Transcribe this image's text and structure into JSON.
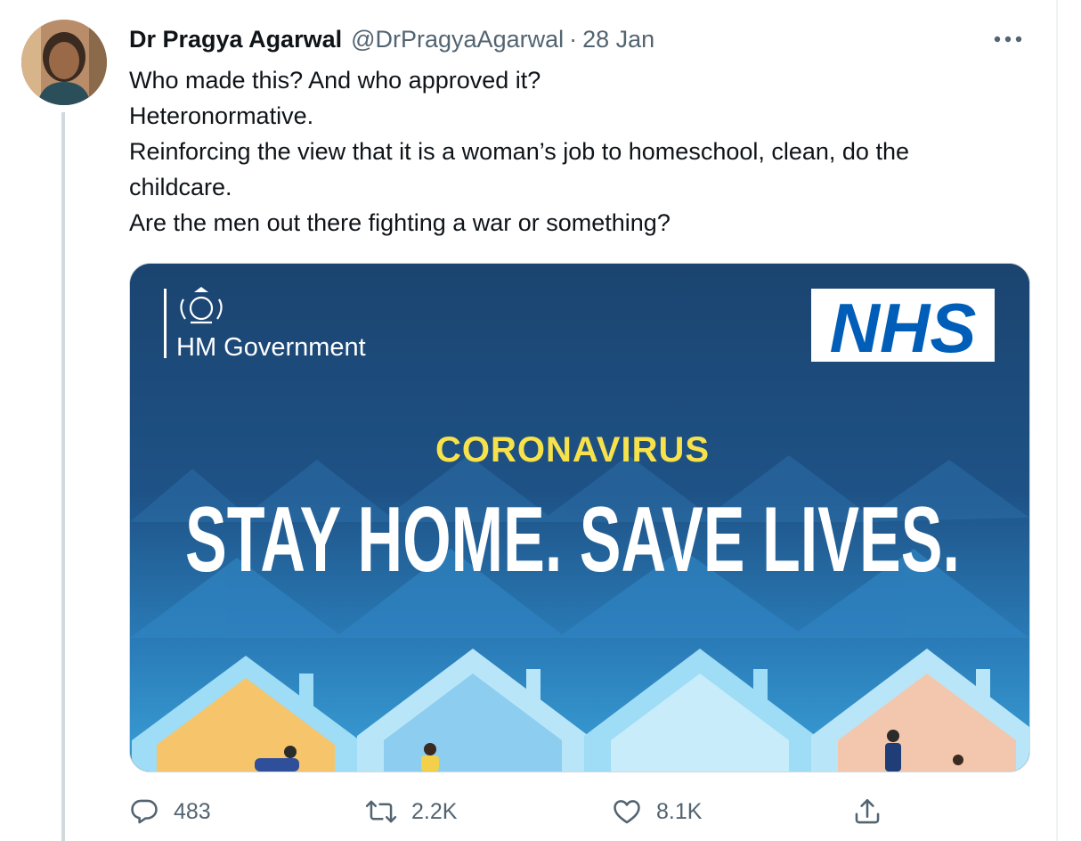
{
  "tweet": {
    "author": {
      "display_name": "Dr Pragya Agarwal",
      "handle": "@DrPragyaAgarwal"
    },
    "separator": "·",
    "date": "28 Jan",
    "text_lines": [
      "Who made this? And who approved it?",
      "Heteronormative.",
      "Reinforcing the view that it is a woman’s job to homeschool, clean, do the",
      "childcare.",
      "Are the men out there fighting a war or something?"
    ],
    "media": {
      "govt_label": "HM Government",
      "nhs_label": "NHS",
      "kicker": "CORONAVIRUS",
      "headline": "STAY HOME. SAVE LIVES."
    },
    "actions": {
      "reply_count": "483",
      "retweet_count": "2.2K",
      "like_count": "8.1K"
    }
  },
  "colors": {
    "text_primary": "#0f1419",
    "text_secondary": "#536471",
    "nhs_blue": "#005eb8",
    "poster_navy": "#1e4c78",
    "poster_yellow": "#f7e24b"
  },
  "icons": {
    "reply": "reply-icon",
    "retweet": "retweet-icon",
    "like": "heart-icon",
    "share": "share-icon",
    "more": "more-icon"
  }
}
